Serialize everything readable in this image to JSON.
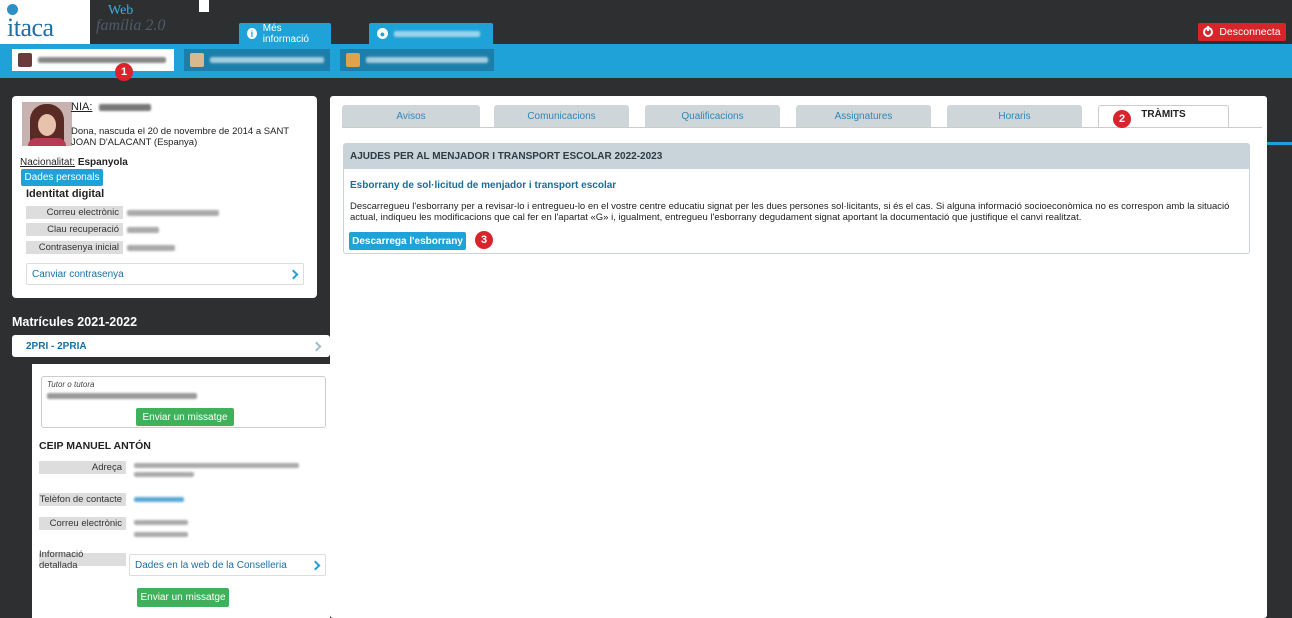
{
  "header": {
    "logo_text": "itaca",
    "brand_line1": "Web",
    "brand_line2": "família 2.0",
    "more_info_label": "Més informació",
    "logout_label": "Desconnecta"
  },
  "badges": [
    "1",
    "2",
    "3"
  ],
  "profile": {
    "nia_label": "NIA:",
    "born_text": "Dona, nascuda el 20 de novembre de 2014 a SANT JOAN D'ALACANT (Espanya)",
    "nationality_label": "Nacionalitat:",
    "nationality_value": "Espanyola",
    "personal_data_button": "Dades personals",
    "digital_identity_title": "Identitat digital",
    "email_label": "Correu electrònic",
    "recovery_key_label": "Clau recuperació",
    "initial_password_label": "Contrasenya inicial",
    "change_password_link": "Canviar contrasenya"
  },
  "enrolments": {
    "title": "Matrícules 2021-2022",
    "group": "2PRI - 2PRIA",
    "tutor_label": "Tutor o tutora",
    "send_message_button": "Enviar un missatge",
    "school_name": "CEIP MANUEL ANTÓN",
    "address_label": "Adreça",
    "phone_label": "Telèfon de contacte",
    "email_label": "Correu electrònic",
    "detail_label": "Informació detallada",
    "detail_link": "Dades en la web de la Conselleria",
    "send_message_button_2": "Enviar un missatge"
  },
  "tabs": [
    {
      "label": "Avisos"
    },
    {
      "label": "Comunicacions"
    },
    {
      "label": "Qualificacions"
    },
    {
      "label": "Assignatures"
    },
    {
      "label": "Horaris"
    },
    {
      "label": "TRÀMITS"
    }
  ],
  "procedure": {
    "section_title": "AJUDES PER AL MENJADOR I TRANSPORT ESCOLAR 2022-2023",
    "draft_title": "Esborrany de sol·licitud de menjador i transport escolar",
    "description": "Descarregueu l'esborrany per a revisar-lo i entregueu-lo en el vostre centre educatiu signat per les dues persones sol·licitants, si és el cas. Si alguna informació socioeconòmica no es correspon amb la situació actual, indiqueu les modificacions que cal fer en l'apartat «G» i, igualment, entregueu l'esborrany degudament signat aportant la documentació que justifique el canvi realitzat.",
    "download_button": "Descarrega l'esborrany"
  },
  "colors": {
    "accent_blue": "#1fa2d7",
    "dark_bg": "#2e2f30",
    "logout_red": "#d8252b",
    "action_green": "#3eb15a",
    "section_header": "#c8d4da"
  }
}
